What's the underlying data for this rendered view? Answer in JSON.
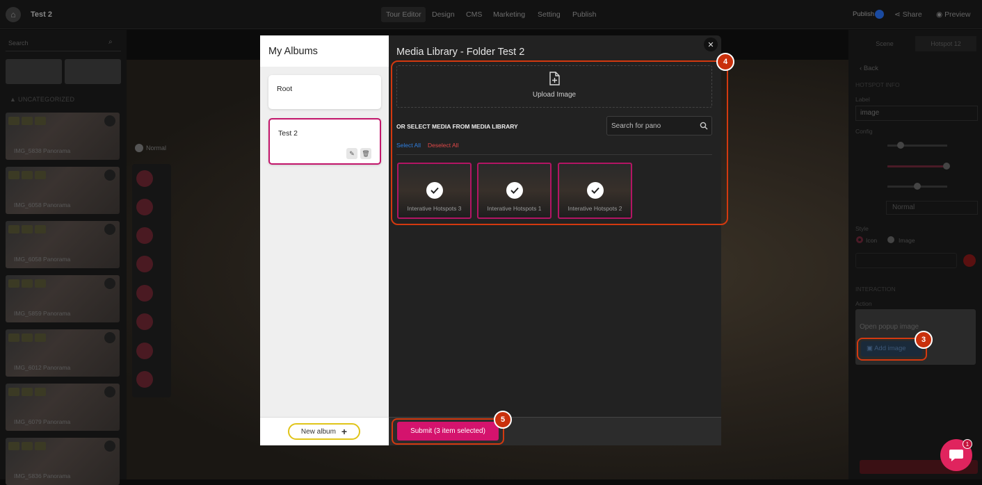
{
  "topbar": {
    "project_title": "Test 2",
    "nav": [
      "Tour Editor",
      "Design",
      "CMS",
      "Marketing",
      "Setting",
      "Publish"
    ],
    "publish_label": "Publish",
    "share_label": "Share",
    "preview_label": "Preview"
  },
  "left_panel": {
    "search_placeholder": "Search",
    "section_label": "UNCATEGORIZED",
    "scenes": [
      "IMG_5838 Panorama",
      "IMG_6058 Panorama",
      "IMG_6058 Panorama",
      "IMG_5859 Panorama",
      "IMG_6012 Panorama",
      "IMG_6079 Panorama",
      "IMG_5836 Panorama"
    ]
  },
  "canvas": {
    "normal_label": "Normal"
  },
  "right_panel": {
    "tabs": [
      "Scene",
      "Hotspot 12"
    ],
    "back_label": "Back",
    "hotspot_info": "HOTSPOT INFO",
    "label_caption": "Label",
    "label_value": "image",
    "config_caption": "Config",
    "offset_value": "Normal",
    "style_caption": "Style",
    "style_options": [
      "Icon",
      "Image"
    ],
    "interaction_caption": "INTERACTION",
    "action_caption": "Action",
    "action_value": "Open popup image",
    "add_image_label": "Add image"
  },
  "modal": {
    "albums_title": "My Albums",
    "albums": [
      {
        "name": "Root",
        "selected": false
      },
      {
        "name": "Test 2",
        "selected": true
      }
    ],
    "new_album_label": "New album",
    "media_title": "Media Library - Folder Test 2",
    "upload_label": "Upload Image",
    "or_select_label": "OR SELECT MEDIA FROM MEDIA LIBRARY",
    "search_placeholder": "Search for pano",
    "select_all_label": "Select All",
    "deselect_all_label": "Deselect All",
    "media_items": [
      {
        "name": "Interative Hotspots 3",
        "selected": true
      },
      {
        "name": "Interative Hotspots 1",
        "selected": true
      },
      {
        "name": "Interative Hotspots 2",
        "selected": true
      }
    ],
    "submit_label": "Submit (3 item selected)"
  },
  "annotations": {
    "marker_3": "3",
    "marker_4": "4",
    "marker_5": "5"
  },
  "chat": {
    "badge": "1"
  },
  "colors": {
    "accent": "#d4136d",
    "annotation_ring": "#d4390f",
    "new_album_ring": "#e0c418",
    "link_blue": "#2f7fe0",
    "link_red": "#e04848"
  }
}
